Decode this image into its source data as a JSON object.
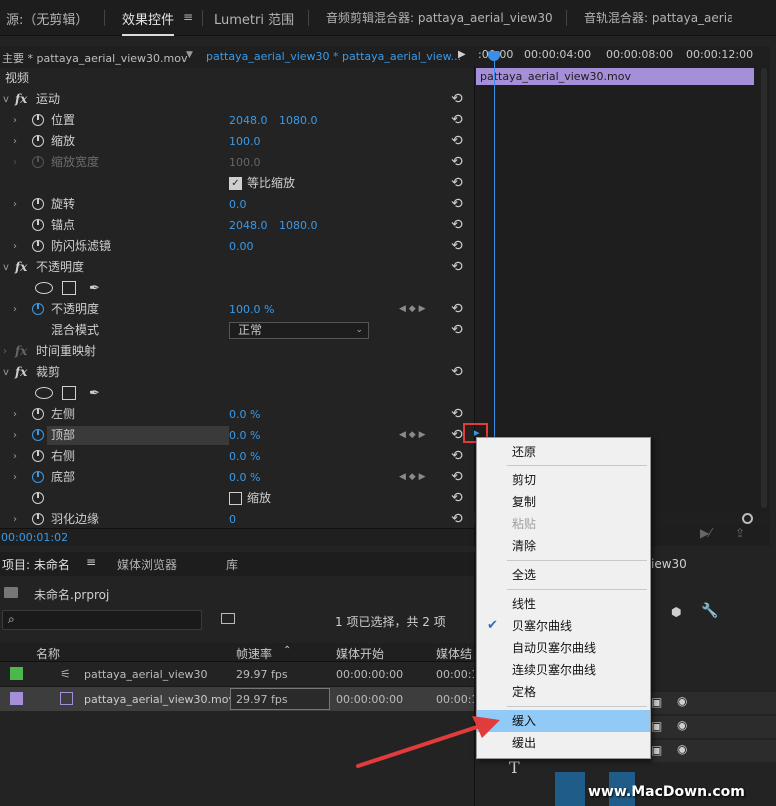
{
  "tabs": {
    "source": "源:（无剪辑）",
    "effect_controls": "效果控件",
    "lumetri": "Lumetri 范围",
    "audio_clip_mixer": "音频剪辑混合器: pattaya_aerial_view30",
    "audio_track_mixer": "音轨混合器: pattaya_aerial_"
  },
  "ec_header": {
    "master": "主要 * pattaya_aerial_view30.mov",
    "sequence": "pattaya_aerial_view30 * pattaya_aerial_view..."
  },
  "ruler": {
    "t0": ":00:00",
    "t1": "00:00:04:00",
    "t2": "00:00:08:00",
    "t3": "00:00:12:00"
  },
  "clip_name": "pattaya_aerial_view30.mov",
  "effects": {
    "video": "视频",
    "motion": "运动",
    "position": "位置",
    "position_x": "2048.0",
    "position_y": "1080.0",
    "scale": "缩放",
    "scale_val": "100.0",
    "scale_width": "缩放宽度",
    "scale_width_val": "100.0",
    "uniform_scale": "等比缩放",
    "rotation": "旋转",
    "rotation_val": "0.0",
    "anchor": "锚点",
    "anchor_x": "2048.0",
    "anchor_y": "1080.0",
    "antiflicker": "防闪烁滤镜",
    "antiflicker_val": "0.00",
    "opacity_group": "不透明度",
    "opacity": "不透明度",
    "opacity_val": "100.0 %",
    "blend_mode": "混合模式",
    "blend_mode_val": "正常",
    "time_remap": "时间重映射",
    "crop": "裁剪",
    "left": "左侧",
    "left_val": "0.0 %",
    "top": "顶部",
    "top_val": "0.0 %",
    "right": "右侧",
    "right_val": "0.0 %",
    "bottom": "底部",
    "bottom_val": "0.0 %",
    "zoom": "缩放",
    "feather": "羽化边缘",
    "feather_val": "0"
  },
  "timecode": "00:00:01:02",
  "project": {
    "tab_project": "项目: 未命名",
    "tab_media_browser": "媒体浏览器",
    "tab_library": "库",
    "file": "未命名.prproj",
    "selection_info": "1 项已选择，共 2 项",
    "columns": {
      "name": "名称",
      "fps": "帧速率",
      "media_start": "媒体开始",
      "media_end": "媒体结"
    },
    "rows": [
      {
        "name": "pattaya_aerial_view30",
        "fps": "29.97 fps",
        "start": "00:00:00:00",
        "end": "00:00:1",
        "color": "#4cb84c"
      },
      {
        "name": "pattaya_aerial_view30.mov",
        "fps": "29.97 fps",
        "start": "00:00:00:00",
        "end": "00:00:1",
        "color": "#a58fd9"
      }
    ]
  },
  "sequence_panel_title": "iew30",
  "context_menu": {
    "restore": "还原",
    "cut": "剪切",
    "copy": "复制",
    "paste": "粘贴",
    "clear": "清除",
    "select_all": "全选",
    "linear": "线性",
    "bezier": "贝塞尔曲线",
    "auto_bezier": "自动贝塞尔曲线",
    "continuous_bezier": "连续贝塞尔曲线",
    "hold": "定格",
    "ease_in": "缓入",
    "ease_out": "缓出"
  },
  "watermark": "www.MacDown.com",
  "colors": {
    "accent": "#3a9ae8",
    "clip": "#a58fd9",
    "highlight_box": "#e23b3b",
    "menu_hover": "#91c9f7",
    "arrow": "#e23b3b"
  }
}
